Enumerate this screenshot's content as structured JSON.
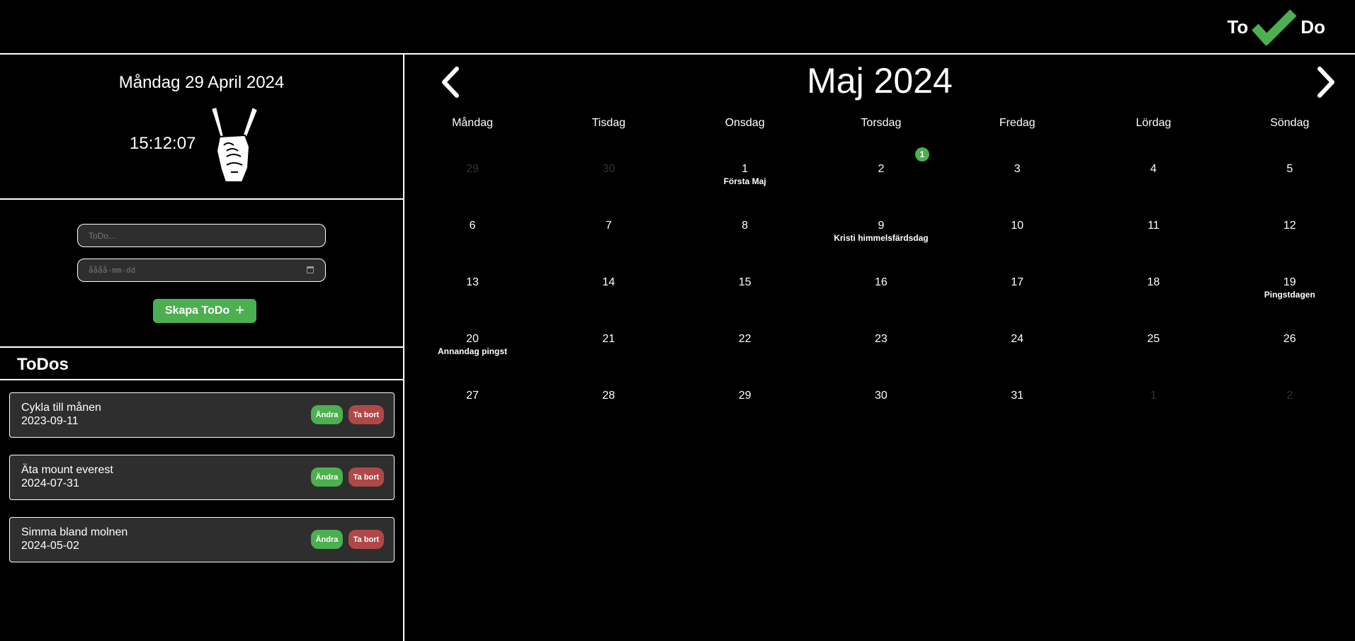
{
  "header": {
    "logo_left": "To",
    "logo_right": "Do"
  },
  "clock": {
    "date": "Måndag 29 April 2024",
    "time": "15:12:07"
  },
  "form": {
    "todo_placeholder": "ToDo...",
    "date_placeholder": "åååå-mm-dd",
    "create_label": "Skapa ToDo",
    "create_icon": "+"
  },
  "todos": {
    "heading": "ToDos",
    "items": [
      {
        "title": "Cykla till månen",
        "date": "2023-09-11",
        "edit": "Ändra",
        "delete": "Ta bort"
      },
      {
        "title": "Äta mount everest",
        "date": "2024-07-31",
        "edit": "Ändra",
        "delete": "Ta bort"
      },
      {
        "title": "Simma bland molnen",
        "date": "2024-05-02",
        "edit": "Ändra",
        "delete": "Ta bort"
      }
    ]
  },
  "calendar": {
    "title": "Maj 2024",
    "weekdays": [
      "Måndag",
      "Tisdag",
      "Onsdag",
      "Torsdag",
      "Fredag",
      "Lördag",
      "Söndag"
    ],
    "weeks": [
      [
        {
          "n": "29",
          "muted": true
        },
        {
          "n": "30",
          "muted": true
        },
        {
          "n": "1",
          "holiday": "Första Maj"
        },
        {
          "n": "2",
          "badge": "1"
        },
        {
          "n": "3"
        },
        {
          "n": "4"
        },
        {
          "n": "5"
        }
      ],
      [
        {
          "n": "6"
        },
        {
          "n": "7"
        },
        {
          "n": "8"
        },
        {
          "n": "9",
          "holiday": "Kristi himmelsfärdsdag"
        },
        {
          "n": "10"
        },
        {
          "n": "11"
        },
        {
          "n": "12"
        }
      ],
      [
        {
          "n": "13"
        },
        {
          "n": "14"
        },
        {
          "n": "15"
        },
        {
          "n": "16"
        },
        {
          "n": "17"
        },
        {
          "n": "18"
        },
        {
          "n": "19",
          "holiday": "Pingstdagen"
        }
      ],
      [
        {
          "n": "20",
          "holiday": "Annandag pingst"
        },
        {
          "n": "21"
        },
        {
          "n": "22"
        },
        {
          "n": "23"
        },
        {
          "n": "24"
        },
        {
          "n": "25"
        },
        {
          "n": "26"
        }
      ],
      [
        {
          "n": "27"
        },
        {
          "n": "28"
        },
        {
          "n": "29"
        },
        {
          "n": "30"
        },
        {
          "n": "31"
        },
        {
          "n": "1",
          "muted": true
        },
        {
          "n": "2",
          "muted": true
        }
      ]
    ]
  },
  "colors": {
    "accent": "#4caf50",
    "danger": "#b04848",
    "panel": "#2e2e2e"
  }
}
